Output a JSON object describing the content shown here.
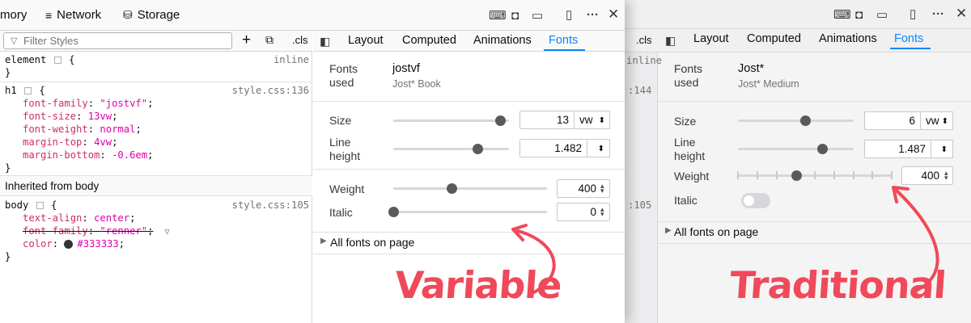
{
  "left_window": {
    "toolbar": {
      "memory_label": "mory",
      "network_label": "Network",
      "storage_label": "Storage"
    },
    "rules": {
      "filter_placeholder": "Filter Styles",
      "cls_label": ".cls",
      "element_selector": "element",
      "element_open": "{",
      "element_close": "}",
      "element_source": "inline",
      "h1_selector": "h1",
      "h1_open": "{",
      "h1_source": "style.css:136",
      "h1_props": [
        {
          "name": "font-family",
          "value": "\"jostvf\""
        },
        {
          "name": "font-size",
          "value": "13vw"
        },
        {
          "name": "font-weight",
          "value": "normal"
        },
        {
          "name": "margin-top",
          "value": "4vw"
        },
        {
          "name": "margin-bottom",
          "value": "-0.6em"
        }
      ],
      "h1_close": "}",
      "inherited_label": "Inherited from body",
      "body_selector": "body",
      "body_open": "{",
      "body_source": "style.css:105",
      "body_props": [
        {
          "name": "text-align",
          "value": "center"
        },
        {
          "name": "font-family",
          "value": "\"renner\""
        },
        {
          "name": "color",
          "value": "#333333"
        }
      ],
      "body_close": "}"
    },
    "tabs": [
      "Layout",
      "Computed",
      "Animations",
      "Fonts"
    ],
    "fonts_panel": {
      "fonts_used_label": "Fonts\nused",
      "font_family": "jostvf",
      "font_face": "Jost* Book",
      "size_label": "Size",
      "size_value": "13",
      "size_unit": "vw",
      "size_fraction": 0.92,
      "line_height_label": "Line\nheight",
      "line_height_value": "1.482",
      "line_height_fraction": 0.73,
      "weight_label": "Weight",
      "weight_value": "400",
      "weight_fraction": 0.38,
      "italic_label": "Italic",
      "italic_value": "0",
      "italic_fraction": 0.0,
      "all_fonts_label": "All fonts on page"
    }
  },
  "right_window": {
    "cls_label": ".cls",
    "gutter_numbers": [
      "inline",
      ":144",
      ":105"
    ],
    "tabs": [
      "Layout",
      "Computed",
      "Animations",
      "Fonts"
    ],
    "fonts_panel": {
      "fonts_used_label": "Fonts\nused",
      "font_family": "Jost*",
      "font_face": "Jost* Medium",
      "size_label": "Size",
      "size_value": "6",
      "size_unit": "vw",
      "size_fraction": 0.58,
      "line_height_label": "Line\nheight",
      "line_height_value": "1.487",
      "line_height_fraction": 0.73,
      "weight_label": "Weight",
      "weight_value": "400",
      "weight_fraction": 0.38,
      "italic_label": "Italic",
      "all_fonts_label": "All fonts on page"
    }
  },
  "annotations": {
    "left": "Variable",
    "right": "Traditional"
  },
  "colors": {
    "accent": "#0a84ff",
    "annotation": "#f0495a",
    "color_swatch": "#333333"
  }
}
